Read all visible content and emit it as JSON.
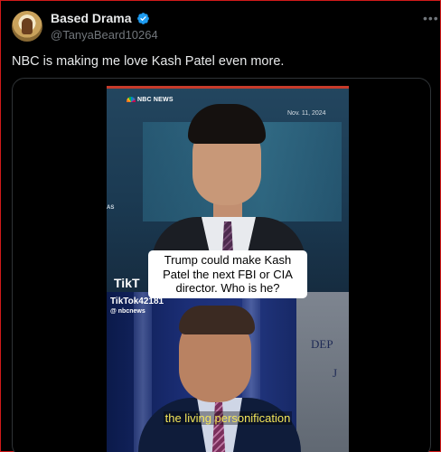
{
  "tweet": {
    "display_name": "Based Drama",
    "handle": "@TanyaBeard10264",
    "text": "NBC is making me love Kash Patel even more.",
    "more_icon": "more-horizontal-icon",
    "verified_icon": "verified-badge-icon"
  },
  "video": {
    "network_logo": "NBC NEWS",
    "date": "Nov. 11, 2024",
    "side_text": "AS",
    "caption": "Trump could make Kash Patel the next FBI or CIA director. Who is he?",
    "tiktok_logo": "TikT",
    "tiktok_user": "TikTok42181",
    "tiktok_source": "@ nbcnews",
    "wall_text_1": "DEP",
    "wall_text_2": "J",
    "subtitle": "the living personification"
  },
  "colors": {
    "background": "#000000",
    "verified": "#1d9bf0",
    "subtitle": "#f4e65a",
    "border": "#d11a1a"
  }
}
